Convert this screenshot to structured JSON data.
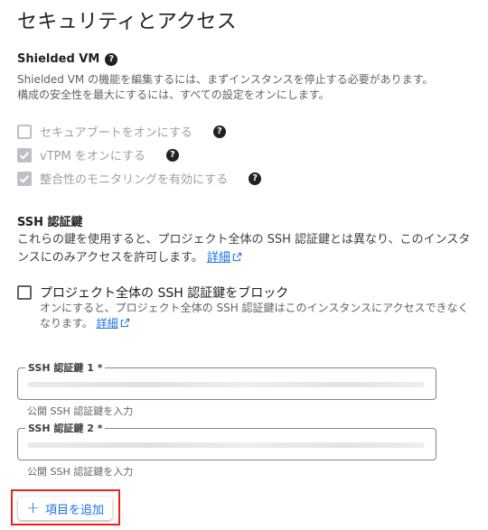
{
  "title": "セキュリティとアクセス",
  "shielded": {
    "heading": "Shielded VM",
    "help_icon": "help-icon",
    "description_line1": "Shielded VM の機能を編集するには、まずインスタンスを停止する必要があります。",
    "description_line2": "構成の安全性を最大にするには、すべての設定をオンにします。",
    "options": [
      {
        "label": "セキュアブートをオンにする",
        "checked": false,
        "disabled": true
      },
      {
        "label": "vTPM をオンにする",
        "checked": true,
        "disabled": true
      },
      {
        "label": "整合性のモニタリングを有効にする",
        "checked": true,
        "disabled": true
      }
    ]
  },
  "ssh": {
    "heading": "SSH 認証鍵",
    "description": "これらの鍵を使用すると、プロジェクト全体の SSH 認証鍵とは異なり、このインスタンスにのみアクセスを許可します。",
    "details_link": "詳細",
    "block_checkbox_label": "プロジェクト全体の SSH 認証鍵をブロック",
    "block_checkbox_desc": "オンにすると、プロジェクト全体の SSH 認証鍵はこのインスタンスにアクセスできなくなります。",
    "block_details_link": "詳細",
    "keys": [
      {
        "label": "SSH 認証鍵 1 *",
        "hint": "公開 SSH 認証鍵を入力"
      },
      {
        "label": "SSH 認証鍵 2 *",
        "hint": "公開 SSH 認証鍵を入力"
      }
    ],
    "add_button": "項目を追加"
  },
  "colors": {
    "accent": "#1a73e8",
    "highlight_box": "#e32421",
    "disabled": "#9aa0a6"
  }
}
